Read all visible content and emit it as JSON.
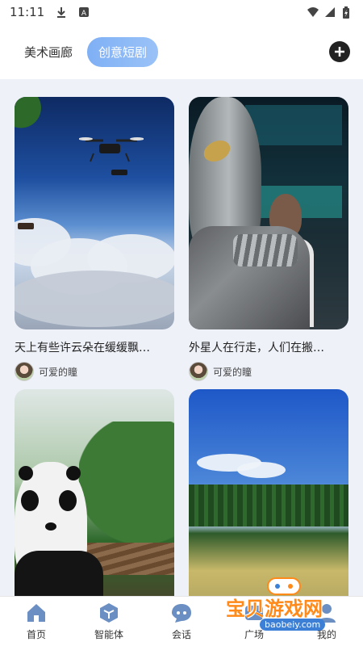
{
  "status_bar": {
    "time": "11:11",
    "icons": [
      "download-icon",
      "a-badge-icon",
      "wifi-icon",
      "signal-icon",
      "battery-icon"
    ]
  },
  "header": {
    "tabs": [
      {
        "label": "美术画廊",
        "active": false
      },
      {
        "label": "创意短剧",
        "active": true
      }
    ],
    "add_icon": "plus-icon"
  },
  "feed": {
    "cards": [
      {
        "title": "天上有些许云朵在缓缓飘…",
        "author": "可爱的瞳",
        "thumbnail": "sky-drones"
      },
      {
        "title": "外星人在行走，人们在搬…",
        "author": "可爱的瞳",
        "thumbnail": "alien-lab"
      },
      {
        "title": "",
        "author": "",
        "thumbnail": "panda-railway"
      },
      {
        "title": "",
        "author": "",
        "thumbnail": "field-forest"
      }
    ]
  },
  "bottom_nav": [
    {
      "label": "首页",
      "icon": "home-icon"
    },
    {
      "label": "智能体",
      "icon": "cube-icon"
    },
    {
      "label": "会话",
      "icon": "chat-icon"
    },
    {
      "label": "广场",
      "icon": "square-icon"
    },
    {
      "label": "我的",
      "icon": "profile-icon"
    }
  ],
  "watermark": {
    "title": "宝贝游戏网",
    "url": "baobeiy.com"
  },
  "colors": {
    "accent": "#8bb8f5",
    "background": "#eef1f8",
    "nav_icon": "#6b8fc2"
  }
}
